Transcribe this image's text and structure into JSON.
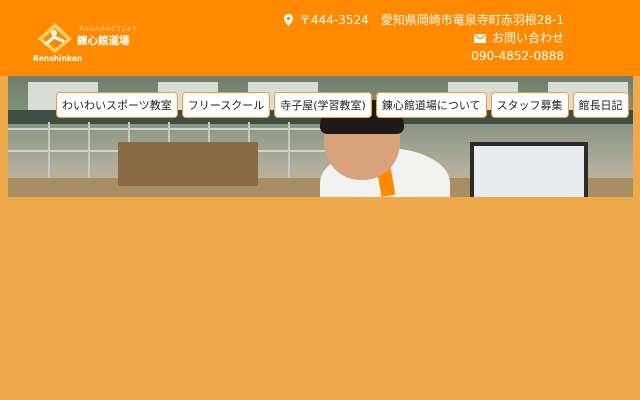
{
  "header": {
    "logo": {
      "sub_text": "れんしんかんどうじょう",
      "name": "錬心館道場",
      "roman": "Renshinkan"
    },
    "contact": {
      "zip": "〒444-3524",
      "address": "愛知県岡崎市竜泉寺町赤羽根28-1",
      "inquiry_label": "お問い合わせ",
      "phone": "090-4852-0888",
      "icons": {
        "location": "map-pin-icon",
        "mail": "envelope-icon"
      }
    }
  },
  "nav": {
    "items": [
      {
        "label": "わいわいスポーツ教室"
      },
      {
        "label": "フリースクール"
      },
      {
        "label": "寺子屋(学習教室)"
      },
      {
        "label": "錬心館道場について"
      },
      {
        "label": "スタッフ募集"
      },
      {
        "label": "館長日記"
      }
    ]
  },
  "colors": {
    "header_bg": "#ff8a00",
    "page_bg": "#eeaa4a",
    "nav_border": "#ff9a2a"
  }
}
